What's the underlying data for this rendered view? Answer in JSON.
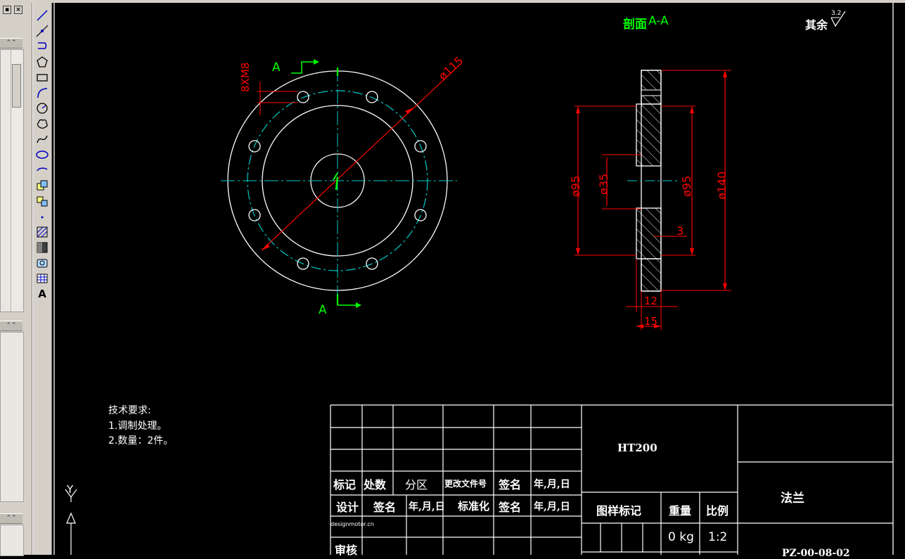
{
  "panel": {
    "close_label": "×",
    "collapse_glyph": "⌃⌃"
  },
  "toolbar": {
    "tools": [
      "line-icon",
      "construction-line-icon",
      "polyline-icon",
      "polygon-icon",
      "rectangle-icon",
      "arc-icon",
      "circle-icon",
      "revision-cloud-icon",
      "spline-icon",
      "ellipse-icon",
      "ellipse-arc-icon",
      "insert-block-icon",
      "make-block-icon",
      "point-icon",
      "hatch-icon",
      "gradient-icon",
      "region-icon",
      "table-icon"
    ],
    "text_tool_label": "A"
  },
  "ucs": {
    "y_label": "Y"
  },
  "drawing": {
    "section_title_prefix": "剖面",
    "section_title_suffix": "A-A",
    "surface_note_label": "其余",
    "surface_note_value": "3.2",
    "cut_label_top": "A",
    "cut_label_bottom": "A",
    "dim_bolt_holes": "8XM8",
    "dim_pcd": "ø115",
    "dim_d95_left": "ø95",
    "dim_d35": "ø35",
    "dim_d95_right": "ø95",
    "dim_d140": "ø140",
    "dim_3": "3",
    "dim_12": "12",
    "dim_15": "15",
    "colors": {
      "geometry": "#ffffff",
      "centerline": "#00c8c8",
      "dimension": "#ff0000",
      "cutline": "#00ff00"
    }
  },
  "tech_req": {
    "title": "技术要求:",
    "items": [
      "1.调制处理。",
      "2.数量：2件。"
    ]
  },
  "title_block": {
    "mark": "标记",
    "count": "处数",
    "zone": "分区",
    "change_doc": "更改文件号",
    "sign1": "签名",
    "date1": "年,月,日",
    "design": "设计",
    "sign2": "签名",
    "date2": "年,月,日",
    "standardize": "标准化",
    "sign3": "签名",
    "date3": "年,月,日",
    "website": "designmotor.cn",
    "review": "审核",
    "material": "HT200",
    "pattern_mark": "图样标记",
    "weight_label": "重量",
    "scale_label": "比例",
    "weight_value": "0 kg",
    "scale_value": "1:2",
    "part_name": "法兰",
    "drawing_no": "PZ-00-08-02"
  }
}
